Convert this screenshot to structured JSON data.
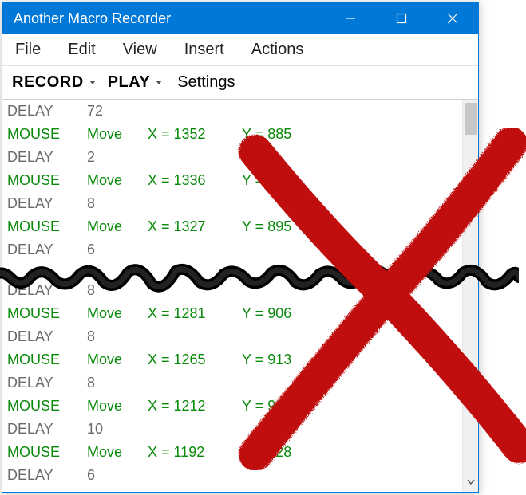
{
  "title": "Another Macro Recorder",
  "menus": [
    "File",
    "Edit",
    "View",
    "Insert",
    "Actions"
  ],
  "toolbar": {
    "record": "RECORD",
    "play": "PLAY",
    "settings": "Settings"
  },
  "rows": [
    {
      "type": "DELAY",
      "c2": "72"
    },
    {
      "type": "MOUSE",
      "c2": "Move",
      "c3": "X = 1352",
      "c4": "Y = 885"
    },
    {
      "type": "DELAY",
      "c2": "2"
    },
    {
      "type": "MOUSE",
      "c2": "Move",
      "c3": "X = 1336",
      "c4": "Y = 891"
    },
    {
      "type": "DELAY",
      "c2": "8"
    },
    {
      "type": "MOUSE",
      "c2": "Move",
      "c3": "X = 1327",
      "c4": "Y = 895"
    },
    {
      "type": "DELAY",
      "c2": "6"
    },
    {
      "type": "DELAY",
      "c2": "8"
    },
    {
      "type": "MOUSE",
      "c2": "Move",
      "c3": "X = 1281",
      "c4": "Y = 906"
    },
    {
      "type": "DELAY",
      "c2": "8"
    },
    {
      "type": "MOUSE",
      "c2": "Move",
      "c3": "X = 1265",
      "c4": "Y = 913"
    },
    {
      "type": "DELAY",
      "c2": "8"
    },
    {
      "type": "MOUSE",
      "c2": "Move",
      "c3": "X = 1212",
      "c4": "Y = 923"
    },
    {
      "type": "DELAY",
      "c2": "10"
    },
    {
      "type": "MOUSE",
      "c2": "Move",
      "c3": "X = 1192",
      "c4": "Y = 928"
    },
    {
      "type": "DELAY",
      "c2": "6"
    }
  ],
  "overlay": {
    "tear": true,
    "red_x": true
  }
}
